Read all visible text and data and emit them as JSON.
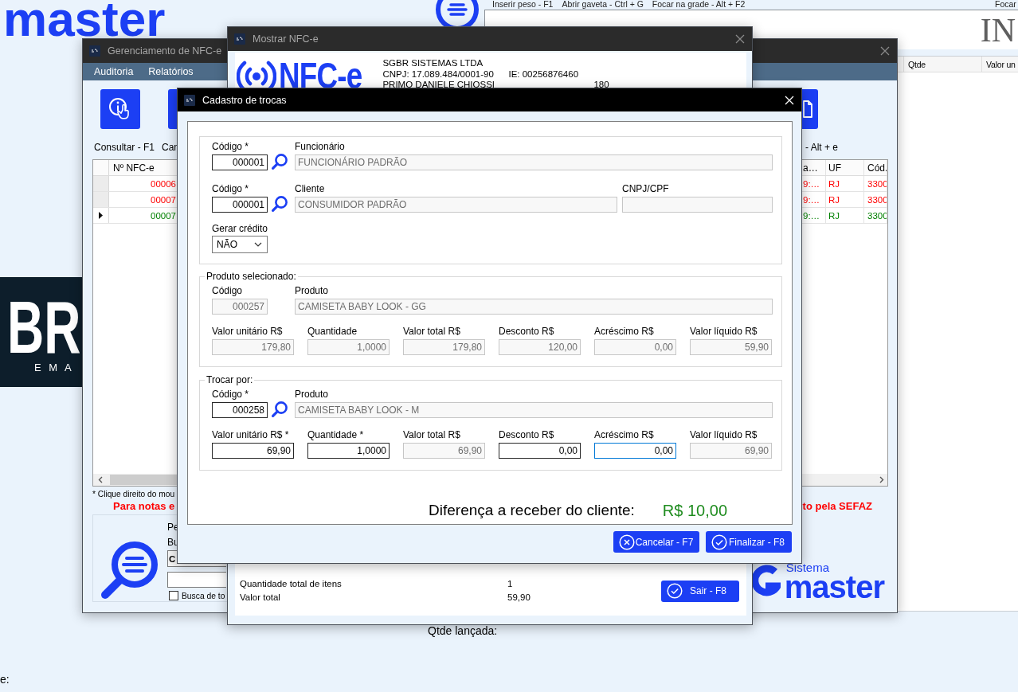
{
  "background": {
    "logo_text": "master",
    "shortcuts": [
      "Inserir peso - F1",
      "Abrir gaveta - Ctrl + G",
      "Focar na grade - Alt + F2"
    ],
    "shortcut_cut": "Focar",
    "display_value": "IN",
    "grid_columns": [
      "Qtde",
      "Valor un"
    ],
    "side_logo": {
      "title": "BR",
      "subtitle": "E M A"
    },
    "quantity_label": "Qtde lançada:",
    "bottom_label": "e:"
  },
  "manager_window": {
    "title": "Gerenciamento de NFC-e",
    "active": false,
    "menu": [
      "Auditoria",
      "Relatórios"
    ],
    "toolbar": [
      {
        "kind": "info",
        "label": "Consultar - F1"
      },
      {
        "kind": "plain",
        "label": "Can"
      },
      {
        "kind": "document",
        "label": "- Alt + e"
      }
    ],
    "grid": {
      "columns": [
        "Nº NFC-e",
        "a…",
        "UF",
        "Cód."
      ],
      "rows": [
        {
          "number": "00006",
          "column_2": "9:…",
          "uf": "RJ",
          "code": "3300",
          "color": "#ff0000",
          "selected": false
        },
        {
          "number": "00007",
          "column_2": "9:…",
          "uf": "RJ",
          "code": "3300",
          "color": "#ff0000",
          "selected": false
        },
        {
          "number": "00007",
          "column_2": "9:…",
          "uf": "RJ",
          "code": "3300",
          "color": "#008000",
          "selected": true
        }
      ]
    },
    "hint": "* Clique direito do mou",
    "warning_left": "Para notas e",
    "warning_right": "to pela SEFAZ",
    "search_panel": {
      "label_1": "Pe",
      "label_2": "Bu",
      "select_value": "C",
      "checkbox": {
        "label": "Busca de to",
        "checked": false
      }
    },
    "brand": {
      "small": "Sistema",
      "large": "master"
    }
  },
  "nfce_window": {
    "title": "Mostrar NFC-e",
    "active": false,
    "logo_text": "NFC-e",
    "company": "SGBR SISTEMAS LTDA",
    "cnpj": "CNPJ: 17.089.484/0001-90",
    "ie": "IE: 00256876460",
    "customer": "PRIMO DANIELE CHIOSSI",
    "customer_value": "180",
    "totals": [
      {
        "label": "Quantidade total de itens",
        "value": "1"
      },
      {
        "label": "Valor total",
        "value": "59,90"
      }
    ],
    "exit_button": {
      "kind": "confirm",
      "label": "Sair - F8"
    }
  },
  "exchange_dialog": {
    "title": "Cadastro de trocas",
    "active": true,
    "people": [
      {
        "lookup": true,
        "fields": [
          {
            "kind": "code",
            "label": "Código *",
            "value": "000001",
            "disabled": false
          },
          {
            "kind": "name",
            "label": "Funcionário",
            "value": "FUNCIONÁRIO PADRÃO",
            "disabled": true
          }
        ]
      },
      {
        "lookup": true,
        "fields": [
          {
            "kind": "code",
            "label": "Código *",
            "value": "000001",
            "disabled": false
          },
          {
            "kind": "name",
            "label": "Cliente",
            "value": "CONSUMIDOR PADRÃO",
            "disabled": true
          },
          {
            "kind": "document",
            "label": "CNPJ/CPF",
            "disabled": true
          }
        ]
      }
    ],
    "credit": {
      "label": "Gerar crédito",
      "value": "NÃO"
    },
    "product_groups": [
      {
        "legend": "Produto selecionado:",
        "lookup": false,
        "fields": [
          {
            "kind": "code",
            "label": "Código",
            "value": "000257",
            "disabled": true
          },
          {
            "kind": "name",
            "label": "Produto",
            "value": "CAMISETA BABY LOOK - GG",
            "disabled": true
          }
        ],
        "amounts": [
          {
            "label": "Valor unitário R$",
            "value": "179,80",
            "disabled": true,
            "focused": false
          },
          {
            "label": "Quantidade",
            "value": "1,0000",
            "disabled": true,
            "focused": false
          },
          {
            "label": "Valor total R$",
            "value": "179,80",
            "disabled": true,
            "focused": false
          },
          {
            "label": "Desconto R$",
            "value": "120,00",
            "disabled": true,
            "focused": false
          },
          {
            "label": "Acréscimo R$",
            "value": "0,00",
            "disabled": true,
            "focused": false
          },
          {
            "label": "Valor líquido R$",
            "value": "59,90",
            "disabled": true,
            "focused": false
          }
        ]
      },
      {
        "legend": "Trocar por:",
        "lookup": true,
        "fields": [
          {
            "kind": "code",
            "label": "Código *",
            "value": "000258",
            "disabled": false
          },
          {
            "kind": "name",
            "label": "Produto",
            "value": "CAMISETA BABY LOOK - M",
            "disabled": true
          }
        ],
        "amounts": [
          {
            "label": "Valor unitário R$ *",
            "value": "69,90",
            "disabled": false,
            "focused": false
          },
          {
            "label": "Quantidade *",
            "value": "1,0000",
            "disabled": false,
            "focused": false
          },
          {
            "label": "Valor total R$",
            "value": "69,90",
            "disabled": true,
            "focused": false
          },
          {
            "label": "Desconto R$",
            "value": "0,00",
            "disabled": false,
            "focused": false
          },
          {
            "label": "Acréscimo R$",
            "value": "0,00",
            "disabled": false,
            "focused": true
          },
          {
            "label": "Valor líquido R$",
            "value": "69,90",
            "disabled": true,
            "focused": false
          }
        ]
      }
    ],
    "difference": {
      "label": "Diferença a receber do cliente:",
      "value": "R$ 10,00"
    },
    "buttons": [
      {
        "kind": "cancel",
        "label": "Cancelar - F7"
      },
      {
        "kind": "confirm",
        "label": "Finalizar - F8"
      }
    ]
  }
}
